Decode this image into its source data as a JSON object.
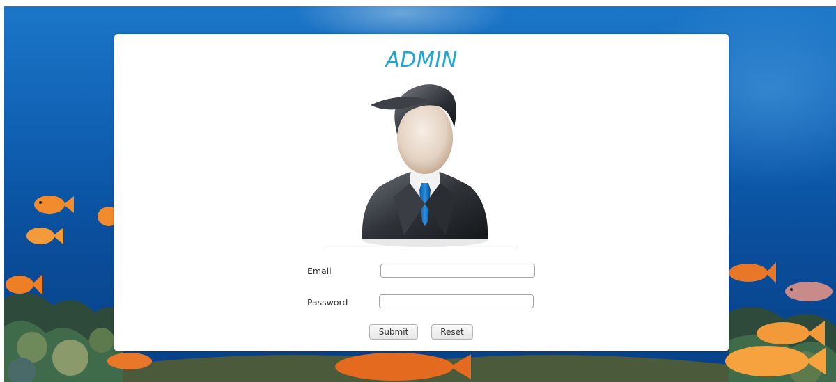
{
  "login_card": {
    "title": "ADMIN",
    "avatar_icon": "admin-user-icon",
    "email_label": "Email",
    "email_value": "",
    "email_placeholder": "",
    "password_label": "Password",
    "password_value": "",
    "password_placeholder": "",
    "submit_label": "Submit",
    "reset_label": "Reset"
  },
  "background": {
    "scene": "coral-reef-underwater",
    "water_color": "#0f5fb2",
    "fish_color": "#f28a2e"
  },
  "colors": {
    "title": "#1ba6d6",
    "card": "#ffffff"
  }
}
